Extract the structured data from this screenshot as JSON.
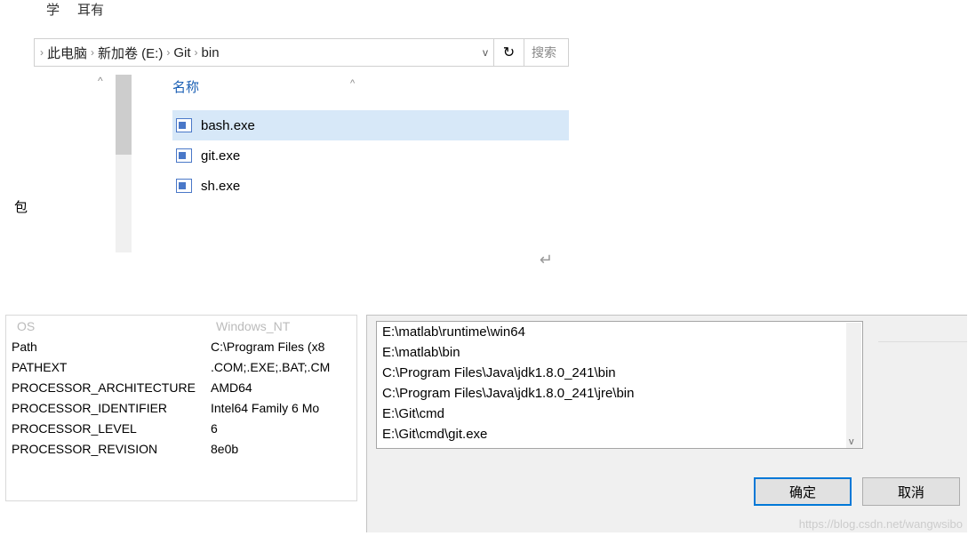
{
  "explorer": {
    "tabs": {
      "t0": "学",
      "t1": "耳有"
    },
    "breadcrumb": {
      "c0": "此电脑",
      "c1": "新加卷 (E:)",
      "c2": "Git",
      "c3": "bin",
      "sep": "›",
      "caret": "v"
    },
    "refresh_glyph": "↻",
    "search_placeholder": "搜索",
    "column_header": "名称",
    "nav_up": "^",
    "sidebar_text": "包",
    "sort_caret": "^",
    "files": [
      {
        "name": "bash.exe",
        "selected": true
      },
      {
        "name": "git.exe",
        "selected": false
      },
      {
        "name": "sh.exe",
        "selected": false
      }
    ],
    "return_glyph": "↵"
  },
  "env_vars": {
    "top_key": "OS",
    "top_val": "Windows_NT",
    "rows": [
      {
        "key": "Path",
        "val": "C:\\Program Files (x8"
      },
      {
        "key": "PATHEXT",
        "val": ".COM;.EXE;.BAT;.CM"
      },
      {
        "key": "PROCESSOR_ARCHITECTURE",
        "val": "AMD64"
      },
      {
        "key": "PROCESSOR_IDENTIFIER",
        "val": "Intel64 Family 6 Mo"
      },
      {
        "key": "PROCESSOR_LEVEL",
        "val": "6"
      },
      {
        "key": "PROCESSOR_REVISION",
        "val": "8e0b"
      }
    ]
  },
  "path_dialog": {
    "entries": [
      "E:\\matlab\\runtime\\win64",
      "E:\\matlab\\bin",
      "C:\\Program Files\\Java\\jdk1.8.0_241\\bin",
      "C:\\Program Files\\Java\\jdk1.8.0_241\\jre\\bin",
      "E:\\Git\\cmd",
      "E:\\Git\\cmd\\git.exe"
    ],
    "ok_label": "确定",
    "cancel_label": "取消",
    "scroll_down": "v"
  },
  "watermark": "https://blog.csdn.net/wangwsibo"
}
